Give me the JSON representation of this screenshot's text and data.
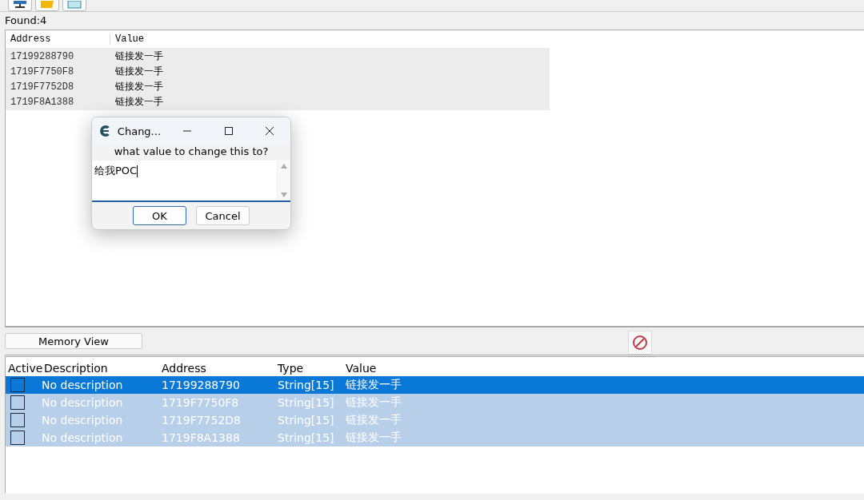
{
  "found_label": "Found:4",
  "results": {
    "columns": [
      "Address",
      "Value"
    ],
    "rows": [
      {
        "address": "17199288790",
        "value": "链接发一手"
      },
      {
        "address": "1719F7750F8",
        "value": "链接发一手"
      },
      {
        "address": "1719F7752D8",
        "value": "链接发一手"
      },
      {
        "address": "1719F8A1388",
        "value": "链接发一手"
      }
    ]
  },
  "dialog": {
    "title": "Chang...",
    "prompt": "what value to change this to?",
    "value": "给我POC",
    "buttons": [
      "OK",
      "Cancel"
    ]
  },
  "memory_view_button": "Memory View",
  "address_list": {
    "columns": [
      "Active",
      "Description",
      "Address",
      "Type",
      "Value"
    ],
    "rows": [
      {
        "active": false,
        "description": "No description",
        "address": "17199288790",
        "type": "String[15]",
        "value": "链接发一手",
        "selected": true
      },
      {
        "active": false,
        "description": "No description",
        "address": "1719F7750F8",
        "type": "String[15]",
        "value": "链接发一手",
        "selected": false
      },
      {
        "active": false,
        "description": "No description",
        "address": "1719F7752D8",
        "type": "String[15]",
        "value": "链接发一手",
        "selected": false
      },
      {
        "active": false,
        "description": "No description",
        "address": "1719F8A1388",
        "type": "String[15]",
        "value": "链接发一手",
        "selected": false
      }
    ]
  }
}
